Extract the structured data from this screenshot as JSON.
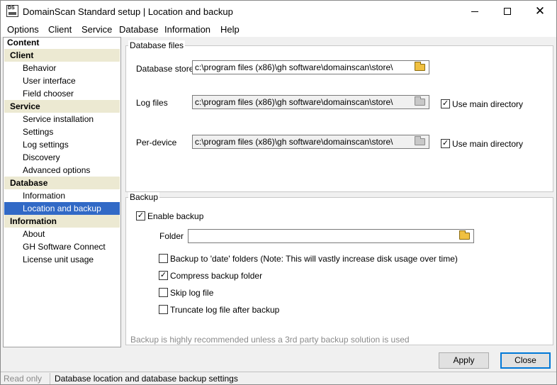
{
  "window": {
    "title": "DomainScan Standard setup | Location and backup",
    "icon_text": "DS",
    "controls": {
      "minimize": "minimize-icon",
      "maximize": "maximize-icon",
      "close": "✕"
    }
  },
  "menu": [
    "Options",
    "Client",
    "Service",
    "Database",
    "Information",
    "Help"
  ],
  "tree": {
    "root": "Content",
    "groups": [
      {
        "label": "Client",
        "items": [
          "Behavior",
          "User interface",
          "Field chooser"
        ]
      },
      {
        "label": "Service",
        "items": [
          "Service installation",
          "Settings",
          "Log settings",
          "Discovery",
          "Advanced options"
        ]
      },
      {
        "label": "Database",
        "items": [
          "Information",
          "Location and backup"
        ]
      },
      {
        "label": "Information",
        "items": [
          "About",
          "GH Software Connect",
          "License unit usage"
        ]
      }
    ],
    "selected": "Location and backup"
  },
  "database_files": {
    "group_label": "Database files",
    "store_label": "Database store",
    "store_value": "c:\\program files (x86)\\gh software\\domainscan\\store\\",
    "log_label": "Log files",
    "log_value": "c:\\program files (x86)\\gh software\\domainscan\\store\\",
    "log_use_main": "Use main directory",
    "device_label": "Per-device",
    "device_value": "c:\\program files (x86)\\gh software\\domainscan\\store\\",
    "device_use_main": "Use main directory"
  },
  "backup": {
    "group_label": "Backup",
    "enable_label": "Enable backup",
    "folder_label": "Folder",
    "folder_value": "",
    "date_folders_label": "Backup to 'date' folders (Note: This will vastly increase disk usage over time)",
    "compress_label": "Compress backup folder",
    "skip_log_label": "Skip log file",
    "truncate_label": "Truncate log file after backup",
    "hint": "Backup is highly recommended unless a 3rd party backup solution is used"
  },
  "buttons": {
    "apply": "Apply",
    "close": "Close"
  },
  "status": {
    "mode": "Read only",
    "text": "Database location and database backup settings"
  }
}
